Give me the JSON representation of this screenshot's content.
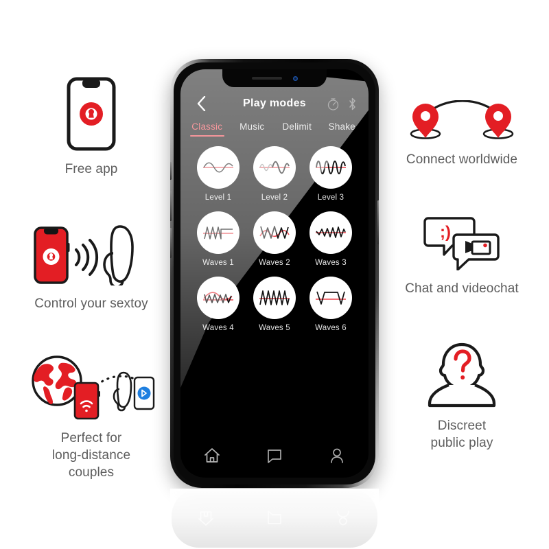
{
  "brand": {
    "red": "#E31E24",
    "tab_red": "#EE3D47",
    "caption_gray": "#5D5D5D",
    "screen_black": "#000000"
  },
  "phone": {
    "notch": {
      "speaker": "speaker-slit",
      "camera": "front-camera"
    },
    "appbar": {
      "back_label": "Back",
      "title": "Play modes",
      "actions": [
        {
          "name": "timer-icon",
          "label": "Timer"
        },
        {
          "name": "bluetooth-icon",
          "label": "Bluetooth"
        }
      ]
    },
    "tabs": [
      {
        "label": "Classic",
        "active": true
      },
      {
        "label": "Music",
        "active": false
      },
      {
        "label": "Delimit",
        "active": false
      },
      {
        "label": "Shake",
        "active": false
      }
    ],
    "modes": [
      {
        "label": "Level 1",
        "icon": "wave-level-1"
      },
      {
        "label": "Level 2",
        "icon": "wave-level-2"
      },
      {
        "label": "Level 3",
        "icon": "wave-level-3"
      },
      {
        "label": "Waves 1",
        "icon": "wave-pattern-1"
      },
      {
        "label": "Waves 2",
        "icon": "wave-pattern-2"
      },
      {
        "label": "Waves 3",
        "icon": "wave-pattern-3"
      },
      {
        "label": "Waves 4",
        "icon": "wave-pattern-4"
      },
      {
        "label": "Waves 5",
        "icon": "wave-pattern-5"
      },
      {
        "label": "Waves 6",
        "icon": "wave-pattern-6"
      }
    ],
    "bottom_nav": [
      {
        "name": "home-icon",
        "label": "Home"
      },
      {
        "name": "chat-icon",
        "label": "Chat"
      },
      {
        "name": "profile-icon",
        "label": "Profile"
      }
    ]
  },
  "features": {
    "free_app": {
      "caption": "Free app",
      "icon": "phone-with-lock-badge-icon"
    },
    "control": {
      "caption": "Control your sextoy",
      "icon": "phone-signal-toy-icon"
    },
    "long_dist": {
      "caption": "Perfect for\nlong-distance\ncouples",
      "icon": "globe-phone-toy-bluetooth-icon"
    },
    "connect": {
      "caption": "Connect worldwide",
      "icon": "two-map-pins-arc-icon"
    },
    "chat": {
      "caption": "Chat and videochat",
      "icon": "speech-bubbles-videocam-icon",
      "emoticon": ";)"
    },
    "discreet": {
      "caption": "Discreet\npublic play",
      "icon": "anonymous-person-question-icon"
    }
  }
}
